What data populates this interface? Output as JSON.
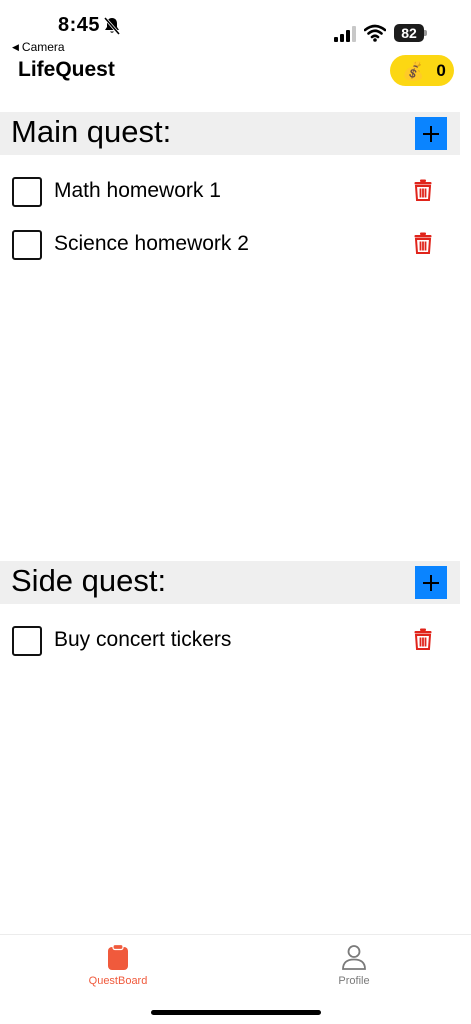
{
  "status_bar": {
    "time": "8:45",
    "back_app": "Camera",
    "battery": "82"
  },
  "header": {
    "title": "LifeQuest",
    "coin_icon": "money-bag-icon",
    "coin_icon_glyph": "💰",
    "coins": "0"
  },
  "main_quest": {
    "title": "Main quest:",
    "items": [
      {
        "label": "Math homework 1",
        "checked": false
      },
      {
        "label": "Science homework 2",
        "checked": false
      }
    ]
  },
  "side_quest": {
    "title": "Side quest:",
    "items": [
      {
        "label": "Buy concert tickers",
        "checked": false
      }
    ]
  },
  "tab_bar": {
    "tabs": [
      {
        "label": "QuestBoard",
        "icon": "clipboard-icon",
        "active": true
      },
      {
        "label": "Profile",
        "icon": "person-icon",
        "active": false
      }
    ]
  },
  "colors": {
    "accent_add": "#0a84ff",
    "delete_red": "#e0241b",
    "coin_pill": "#fcd713",
    "tab_active": "#f05a3c",
    "tab_inactive": "#7a7a7a",
    "section_bg": "#efefef"
  }
}
